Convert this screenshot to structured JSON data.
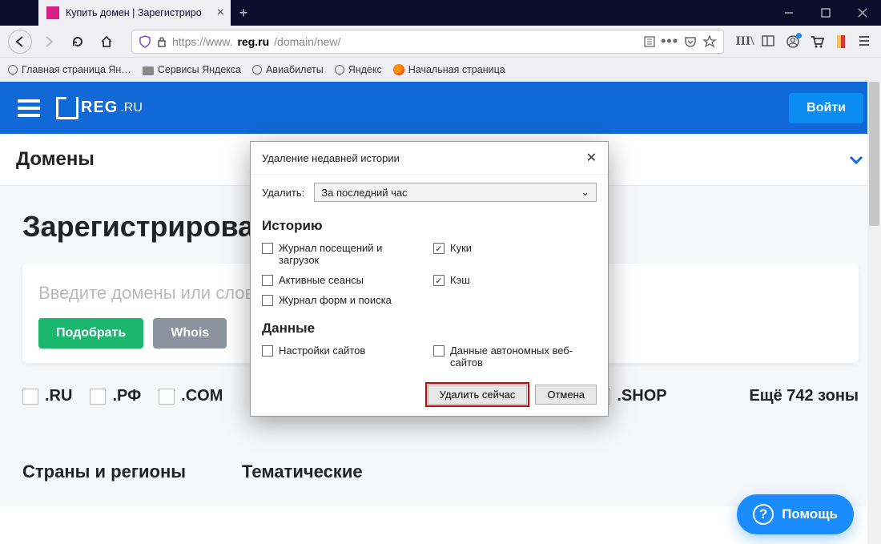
{
  "window": {
    "tab_title": "Купить домен | Зарегистриро"
  },
  "url": {
    "scheme": "https://www.",
    "host": "reg.ru",
    "path": "/domain/new/"
  },
  "bookmarks": [
    {
      "label": "Главная страница Ян…",
      "type": "globe"
    },
    {
      "label": "Сервисы Яндекса",
      "type": "folder"
    },
    {
      "label": "Авиабилеты",
      "type": "globe"
    },
    {
      "label": "Яндекс",
      "type": "globe"
    },
    {
      "label": "Начальная страница",
      "type": "ff"
    }
  ],
  "site": {
    "logo_reg": "REG",
    "logo_ru": ".RU",
    "login": "Войти",
    "category": "Домены",
    "h1": "Зарегистрировать домен",
    "search_placeholder": "Введите домены или слова",
    "btn_pick": "Подобрать",
    "btn_whois": "Whois",
    "zones": [
      ".RU",
      ".РФ",
      ".COM",
      ".SHOP"
    ],
    "more_zones": "Ещё 742 зоны",
    "tab_a": "Страны и регионы",
    "tab_b": "Тематические",
    "help": "Помощь"
  },
  "dialog": {
    "title": "Удаление недавней истории",
    "delete_label": "Удалить:",
    "range": "За последний час",
    "history_section": "Историю",
    "data_section": "Данные",
    "opts": {
      "visits": "Журнал посещений и загрузок",
      "cookies": "Куки",
      "sessions": "Активные сеансы",
      "cache": "Кэш",
      "forms": "Журнал форм и поиска",
      "site_settings": "Настройки сайтов",
      "offline": "Данные автономных веб-сайтов"
    },
    "btn_ok": "Удалить сейчас",
    "btn_cancel": "Отмена"
  }
}
